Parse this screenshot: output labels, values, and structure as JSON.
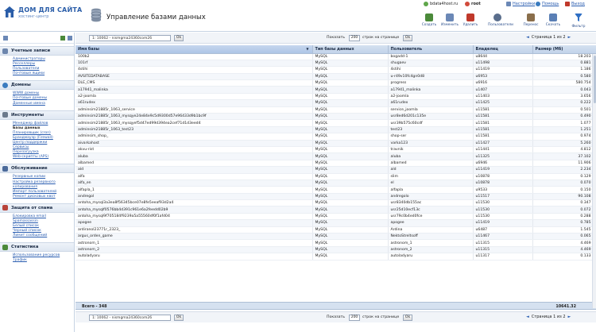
{
  "logo": {
    "line1": "ДОМ ДЛЯ САЙТА",
    "line2": "хостинг-центр"
  },
  "page_title": "Управление базами данных",
  "topbar": {
    "host": "bdata4host.ru",
    "user": "root",
    "settings": "Настройки",
    "help": "Помощь",
    "logout": "Выход"
  },
  "toolbar": [
    {
      "label": "Создать",
      "icon": "create-icon",
      "color": "#4b8a3a"
    },
    {
      "label": "Изменить",
      "icon": "edit-icon",
      "color": "#6b88b6"
    },
    {
      "label": "Удалить",
      "icon": "delete-icon",
      "color": "#c0392b"
    },
    {
      "label": "Пользователи",
      "icon": "users-icon",
      "color": "#5a6e8c"
    },
    {
      "label": "Перенос",
      "icon": "transfer-icon",
      "color": "#8a6e4b"
    },
    {
      "label": "Скачать",
      "icon": "download-icon",
      "color": "#5a7fb5"
    },
    {
      "label": "Фильтр",
      "icon": "filter-icon",
      "color": "#2f6fc4"
    }
  ],
  "sidebar": {
    "sections": [
      {
        "title": "Учетные записи",
        "color": "#6d86ad",
        "items": [
          "Администраторы",
          "Ресселлеры",
          "Пользователи",
          "Почтовые ящики"
        ]
      },
      {
        "title": "Домены",
        "color": "#3a7bbf",
        "items": [
          "WWW домены",
          "Почтовые домены",
          "Доменные имена"
        ]
      },
      {
        "title": "Инструменты",
        "color": "#6b7a8c",
        "items": [
          "Менеджер файлов",
          "Базы данных",
          "Планировщик (cron)",
          "Брандмауэр (Firewall)",
          "Центр поддержки",
          "Сервисы",
          "Перезагрузка",
          "Web-скрипты (APS)"
        ]
      },
      {
        "title": "Обслуживание",
        "color": "#4b6a9a",
        "items": [
          "Резервные копии",
          "Настройка резервного копирования",
          "Импорт пользователей",
          "Ремонт дисковых квот"
        ]
      },
      {
        "title": "Защита от спама",
        "color": "#b8433a",
        "items": [
          "Блокировка email",
          "Spamassassin",
          "Белый список",
          "Черный список",
          "Лимит сообщений"
        ]
      },
      {
        "title": "Статистика",
        "color": "#4c8a3a",
        "items": [
          "Использование ресурсов",
          "Трафик"
        ]
      }
    ]
  },
  "pager": {
    "db_select": "1: 10062 - nismgma24360com26",
    "ok": "Ok",
    "show_label": "Показать",
    "per_page": "200",
    "rows_label": "строк на странице",
    "page_text": "Страница 1 из 2",
    "bottom_page_text": "Страница 1 из 2"
  },
  "table": {
    "columns": [
      "Имя базы",
      "Тип базы данных",
      "Пользователь",
      "Владелец",
      "Размер (Мб)"
    ],
    "rows": [
      [
        "100b2",
        "MySQL",
        "bogadd-1",
        "u8644",
        "18.203"
      ],
      [
        "101rf",
        "MySQL",
        "shugaev",
        "u11498",
        "0.881"
      ],
      [
        "4stihi",
        "MySQL",
        "4stihi",
        "u11419",
        "1.186"
      ],
      [
        "AVSITEDATABASE",
        "MySQL",
        "u-r49v10fc4gn0d8",
        "u6953",
        "0.580"
      ],
      [
        "DLE_CMS",
        "MySQL",
        "progress",
        "u6916",
        "580.754"
      ],
      [
        "a17941_malinka",
        "MySQL",
        "a17941_malinka",
        "u1407",
        "0.043"
      ],
      [
        "a2-joomla",
        "MySQL",
        "a2-joomla",
        "u11403",
        "3.656"
      ],
      [
        "a61rudex",
        "MySQL",
        "a61rudex",
        "u11425",
        "0.222"
      ],
      [
        "adminsim21885r_1063_service",
        "MySQL",
        "service_joomla",
        "u11581",
        "0.501"
      ],
      [
        "adminsim21885r_1063_mysqye24e84e9c5d9300d57e96433d9b1bc9f",
        "MySQL",
        "usr8ed6d201c135e",
        "u11581",
        "0.490"
      ],
      [
        "adminsim21885r_1063_mysqyef5d47ed99d394ea2cef71d1d3eed4",
        "MySQL",
        "usr39b575c60cdf",
        "u11581",
        "1.077"
      ],
      [
        "adminsim21885r_1063_test23",
        "MySQL",
        "test23",
        "u11581",
        "1.251"
      ],
      [
        "adminsim_shop_",
        "MySQL",
        "shop-ser",
        "u11581",
        "0.974"
      ],
      [
        "aivarkahost",
        "MySQL",
        "varka123",
        "u11427",
        "5.260"
      ],
      [
        "akvu-rist",
        "MySQL",
        "travnik",
        "u11441",
        "4.812"
      ],
      [
        "aluba",
        "MySQL",
        "aluba",
        "u11325",
        "37.102"
      ],
      [
        "albamed",
        "MySQL",
        "albamed",
        "u6946",
        "11.906"
      ],
      [
        "ald",
        "MySQL",
        "ald",
        "u11419",
        "2.234"
      ],
      [
        "alfa",
        "MySQL",
        "slim",
        "u10878",
        "0.129"
      ],
      [
        "alfa_en",
        "MySQL",
        "el",
        "u10878",
        "0.070"
      ],
      [
        "alfapla_1",
        "MySQL",
        "alfapla",
        "u9533",
        "0.150"
      ],
      [
        "andregol",
        "MySQL",
        "andregolo",
        "u11517",
        "90.108"
      ],
      [
        "antoha_mysql3a3ea8f56345bce07e8fe5eeaf93d2a4",
        "MySQL",
        "usr8340db155ac",
        "u11530",
        "0.347"
      ],
      [
        "antoha_mysqlf0576bb4d391c961e6a2feedd02b9",
        "MySQL",
        "usr25d10ecf13c",
        "u11530",
        "0.072"
      ],
      [
        "antoha_mysql9f705184f9239a5a55560df0f1afd04",
        "MySQL",
        "usr79c0b4ed0fce",
        "u11530",
        "0.288"
      ],
      [
        "apogee",
        "MySQL",
        "apogee",
        "u11419",
        "0.785"
      ],
      [
        "ardiranol23771r_2323_",
        "MySQL",
        "Ardina",
        "u6487",
        "1.545"
      ],
      [
        "argus_orden_game",
        "MySQL",
        "NektoStreltsoff",
        "u11467",
        "0.065"
      ],
      [
        "astronom_1",
        "MySQL",
        "astronom_1",
        "u11315",
        "4.469"
      ],
      [
        "astronom_2",
        "MySQL",
        "astronom_2",
        "u11315",
        "4.469"
      ],
      [
        "autoladyaru",
        "MySQL",
        "autoladyaru",
        "u11317",
        "0.133"
      ]
    ],
    "summary": {
      "total": "Всего - 348",
      "size": "10641.32"
    }
  }
}
